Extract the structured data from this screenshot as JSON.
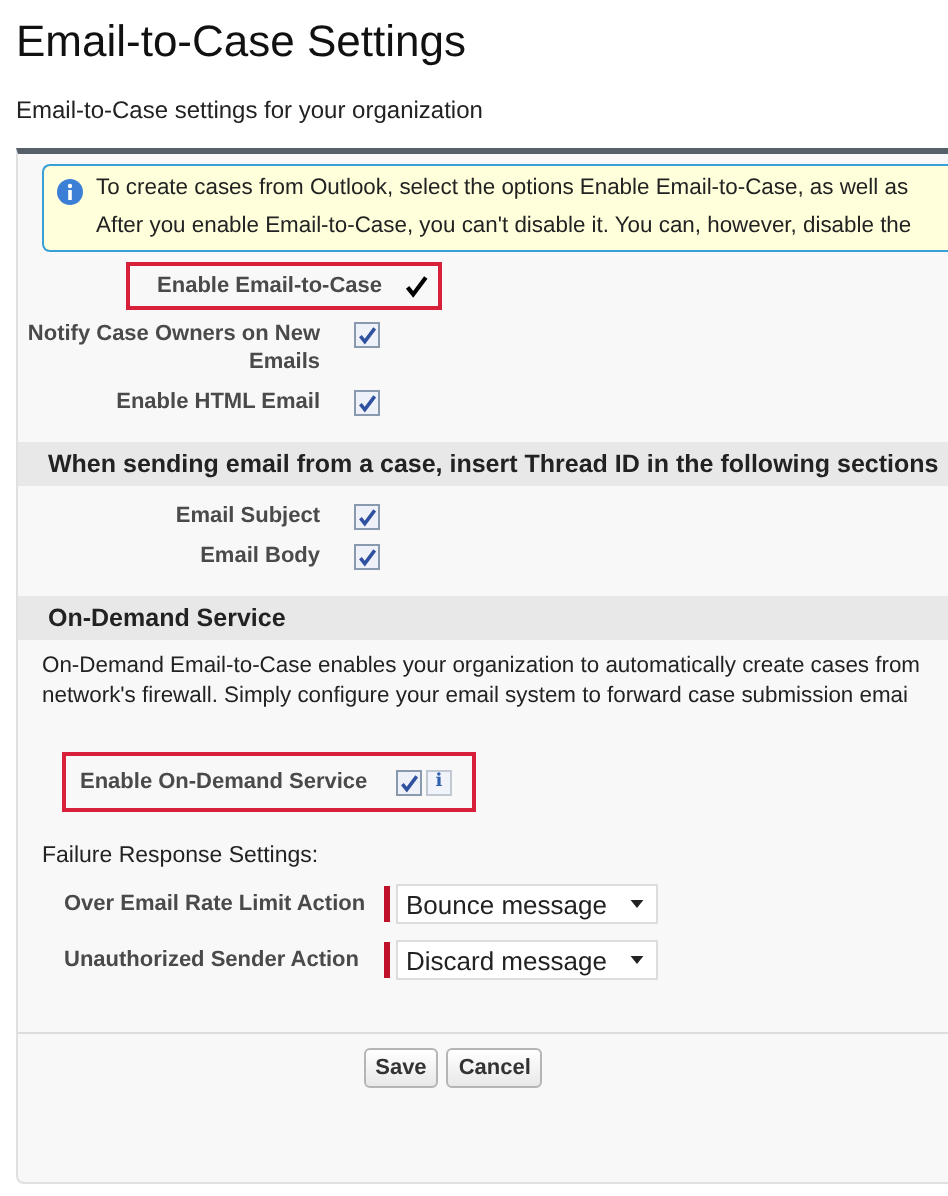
{
  "page": {
    "title": "Email-to-Case Settings",
    "subtitle": "Email-to-Case settings for your organization"
  },
  "info": {
    "lines": [
      "To create cases from Outlook, select the options Enable Email-to-Case, as well as",
      "After you enable Email-to-Case, you can't disable it. You can, however, disable the"
    ]
  },
  "settings": [
    {
      "label": "Enable Email-to-Case",
      "kind": "checkmark",
      "checked": true,
      "highlighted": true
    },
    {
      "label": "Notify Case Owners on New Emails",
      "kind": "checkbox",
      "checked": true,
      "highlighted": false
    },
    {
      "label": "Enable HTML Email",
      "kind": "checkbox",
      "checked": true,
      "highlighted": false
    }
  ],
  "thread_section": {
    "heading": "When sending email from a case, insert Thread ID in the following sections",
    "settings": [
      {
        "label": "Email Subject",
        "kind": "checkbox",
        "checked": true
      },
      {
        "label": "Email Body",
        "kind": "checkbox",
        "checked": true
      }
    ]
  },
  "on_demand": {
    "heading": "On-Demand Service",
    "description": [
      "On-Demand Email-to-Case enables your organization to automatically create cases from",
      "network's firewall. Simply configure your email system to forward case submission emai"
    ],
    "setting": {
      "label": "Enable On-Demand Service",
      "checked": true,
      "highlighted": true,
      "info": "i"
    },
    "failure_heading": "Failure Response Settings:",
    "selects": [
      {
        "label": "Over Email Rate Limit Action",
        "value": "Bounce message",
        "required": true
      },
      {
        "label": "Unauthorized Sender Action",
        "value": "Discard message",
        "required": true
      }
    ]
  },
  "buttons": [
    "Save",
    "Cancel"
  ]
}
